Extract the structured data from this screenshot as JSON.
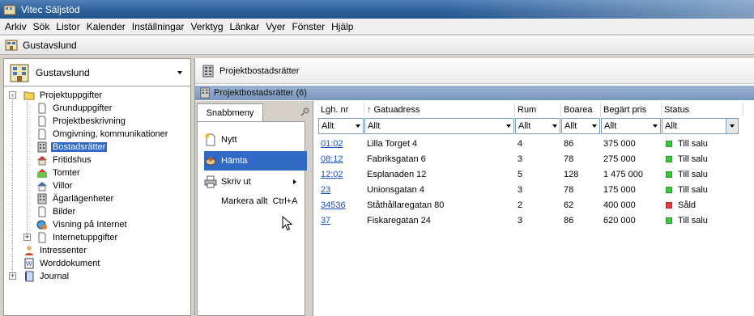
{
  "window": {
    "title": "Vitec Säljstöd"
  },
  "menu": [
    "Arkiv",
    "Sök",
    "Listor",
    "Kalender",
    "Inställningar",
    "Verktyg",
    "Länkar",
    "Vyer",
    "Fönster",
    "Hjälp"
  ],
  "location": {
    "title": "Gustavslund"
  },
  "left_pane": {
    "selector_label": "Gustavslund",
    "tree": [
      {
        "label": "Projektuppgifter",
        "level": 0,
        "expander": "-",
        "icon": "folder-icon"
      },
      {
        "label": "Grunduppgifter",
        "level": 1,
        "icon": "document-icon"
      },
      {
        "label": "Projektbeskrivning",
        "level": 1,
        "icon": "document-icon"
      },
      {
        "label": "Omgivning, kommunikationer",
        "level": 1,
        "icon": "document-icon"
      },
      {
        "label": "Bostadsrätter",
        "level": 1,
        "icon": "apartment-building-icon",
        "selected": true
      },
      {
        "label": "Fritidshus",
        "level": 1,
        "icon": "cottage-icon"
      },
      {
        "label": "Tomter",
        "level": 1,
        "icon": "plot-icon"
      },
      {
        "label": "Villor",
        "level": 1,
        "icon": "villa-icon"
      },
      {
        "label": "Ägarlägenheter",
        "level": 1,
        "icon": "apartment-building-icon"
      },
      {
        "label": "Bilder",
        "level": 1,
        "icon": "document-icon"
      },
      {
        "label": "Visning på Internet",
        "level": 1,
        "icon": "globe-icon"
      },
      {
        "label": "Internetuppgifter",
        "level": 1,
        "expander": "+",
        "icon": "document-icon"
      },
      {
        "label": "Intressenter",
        "level": 0,
        "icon": "person-icon"
      },
      {
        "label": "Worddokument",
        "level": 0,
        "icon": "word-document-icon"
      },
      {
        "label": "Journal",
        "level": 0,
        "expander": "+",
        "icon": "journal-icon"
      }
    ]
  },
  "right_pane": {
    "header_title": "Projektbostadsrätter",
    "sub_title": "Projektbostadsrätter (6)",
    "snabbmeny": {
      "tab_label": "Snabbmeny",
      "items": [
        {
          "label": "Nytt",
          "icon": "new-document-icon"
        },
        {
          "label": "Hämta",
          "icon": "fetch-icon",
          "highlighted": true
        },
        {
          "label": "Skriv ut",
          "icon": "printer-icon",
          "submenu": true
        },
        {
          "label": "Markera allt  Ctrl+A",
          "icon": ""
        }
      ]
    },
    "grid": {
      "columns": [
        "Lgh. nr",
        "Gatuadress",
        "Rum",
        "Boarea",
        "Begärt pris",
        "Status"
      ],
      "filters": [
        "Allt",
        "Allt",
        "Allt",
        "Allt",
        "Allt",
        "Allt"
      ],
      "rows": [
        {
          "lgh": "01:02",
          "gatuadress": "Lilla Torget 4",
          "rum": "4",
          "boarea": "86",
          "pris": "375 000",
          "status": "Till salu",
          "status_color": "#3cc83c"
        },
        {
          "lgh": "08:12",
          "gatuadress": "Fabriksgatan 6",
          "rum": "3",
          "boarea": "78",
          "pris": "275 000",
          "status": "Till salu",
          "status_color": "#3cc83c"
        },
        {
          "lgh": "12:02",
          "gatuadress": "Esplanaden 12",
          "rum": "5",
          "boarea": "128",
          "pris": "1 475 000",
          "status": "Till salu",
          "status_color": "#3cc83c"
        },
        {
          "lgh": "23",
          "gatuadress": "Unionsgatan 4",
          "rum": "3",
          "boarea": "78",
          "pris": "175 000",
          "status": "Till salu",
          "status_color": "#3cc83c"
        },
        {
          "lgh": "34536",
          "gatuadress": "Ståthållaregatan 80",
          "rum": "2",
          "boarea": "62",
          "pris": "400 000",
          "status": "Såld",
          "status_color": "#e03c3c"
        },
        {
          "lgh": "37",
          "gatuadress": "Fiskaregatan 24",
          "rum": "3",
          "boarea": "86",
          "pris": "620 000",
          "status": "Till salu",
          "status_color": "#3cc83c"
        }
      ]
    }
  }
}
